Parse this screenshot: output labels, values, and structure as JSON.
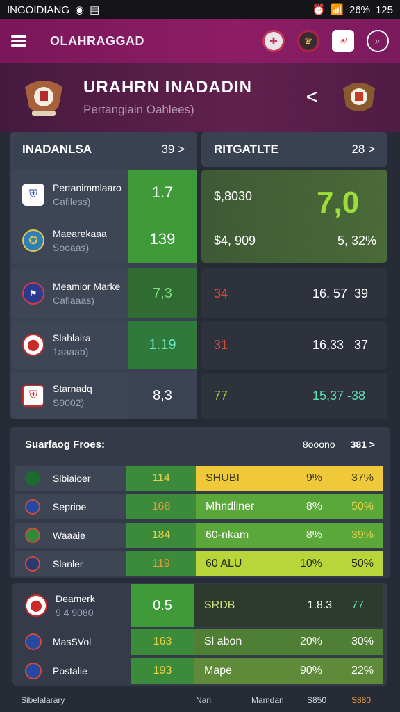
{
  "status": {
    "carrier": "INGOIDIANG",
    "battery": "26%",
    "time": "125"
  },
  "app": {
    "title": "OLAHRAGGAD"
  },
  "hero": {
    "title": "URAHRN INADADIN",
    "subtitle": "Pertangiain Oahlees)",
    "back": "<"
  },
  "left_panel": {
    "title": "INADANLSA",
    "count": "39 >",
    "rows": [
      {
        "name": "Pertanimmlaaro",
        "sub": "Cafiless)",
        "score": "1.7"
      },
      {
        "name": "Maearekaaa",
        "sub": "Sooaas)",
        "score": "139"
      },
      {
        "name": "Meamior Marke",
        "sub": "Cafiaaas)",
        "score": "7,3"
      },
      {
        "name": "Slahlaira",
        "sub": "1aaaab)",
        "score": "1.19"
      },
      {
        "name": "Starnadq",
        "sub": "S9002)",
        "score": "8,3"
      }
    ]
  },
  "right_panel": {
    "title": "RITGATLTE",
    "count": "28 >",
    "top": {
      "v1": "$,8030",
      "v2": "$4, 909",
      "big": "7,0",
      "pct": "5, 32%"
    },
    "rows": [
      {
        "a": "34",
        "b": "16. 57",
        "c": "39"
      },
      {
        "a": "31",
        "b": "16,33",
        "c": "37"
      },
      {
        "a": "77",
        "b": "15,37",
        "c": "-38"
      }
    ]
  },
  "standings": {
    "title": "Suarfaog Froes:",
    "col": "8ooono",
    "count": "381 >",
    "rows": [
      {
        "name": "Sibiaioer",
        "score": "114",
        "bar": "SHUBI",
        "p1": "9%",
        "p2": "37%"
      },
      {
        "name": "Seprioe",
        "score": "168",
        "bar": "Mhndliner",
        "p1": "8%",
        "p2": "50%"
      },
      {
        "name": "Waaaie",
        "score": "184",
        "bar": "60-nkam",
        "p1": "8%",
        "p2": "39%"
      },
      {
        "name": "Slanler",
        "score": "119",
        "bar": "60 ALU",
        "p1": "10%",
        "p2": "50%"
      }
    ]
  },
  "bottom": {
    "rows": [
      {
        "name": "Deamerk",
        "sub": "9 4 9080",
        "score": "0.5",
        "bar": "SRDB",
        "p1": "1.8.3",
        "p2": "77"
      },
      {
        "name": "MasSVol",
        "sub": "",
        "score": "163",
        "bar": "Sl abon",
        "p1": "20%",
        "p2": "30%"
      },
      {
        "name": "Postalie",
        "sub": "",
        "score": "193",
        "bar": "Mape",
        "p1": "90%",
        "p2": "22%"
      }
    ]
  },
  "footer": {
    "a": "Sibelalarary",
    "b": "Nan",
    "c": "Mamdan",
    "d": "S850",
    "e": "S880"
  }
}
